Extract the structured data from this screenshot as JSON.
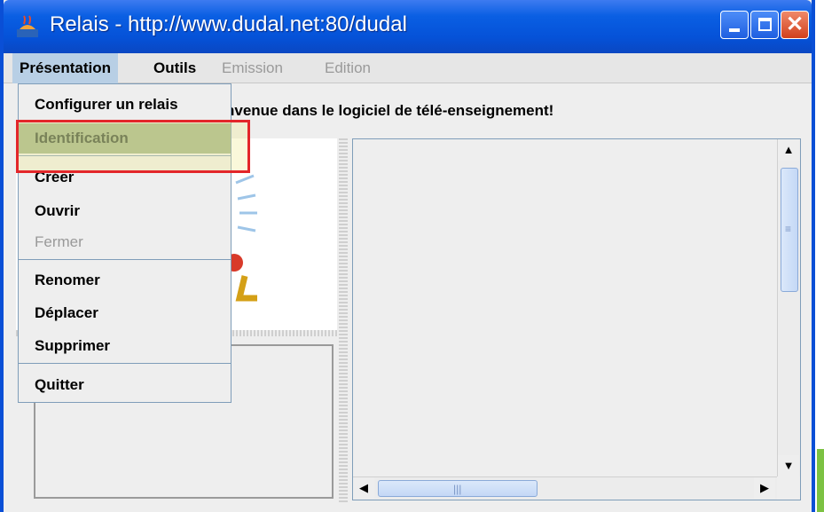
{
  "window": {
    "title": "Relais - http://www.dudal.net:80/dudal"
  },
  "menubar": {
    "items": [
      {
        "label": "Présentation"
      },
      {
        "label": "Outils"
      },
      {
        "label": "Emission"
      },
      {
        "label": "Edition"
      }
    ]
  },
  "welcome_text": "nvenue dans le logiciel de télé-enseignement!",
  "dropdown": {
    "items": [
      {
        "label": "Configurer un relais"
      },
      {
        "label": "Identification"
      },
      {
        "label": "Créer"
      },
      {
        "label": "Ouvrir"
      },
      {
        "label": "Fermer"
      },
      {
        "label": "Renomer"
      },
      {
        "label": "Déplacer"
      },
      {
        "label": "Supprimer"
      },
      {
        "label": "Quitter"
      }
    ]
  },
  "colors": {
    "highlight": "#e3262a",
    "title_bar": "#0a5fe3",
    "selected_item": "#9fb38a"
  }
}
